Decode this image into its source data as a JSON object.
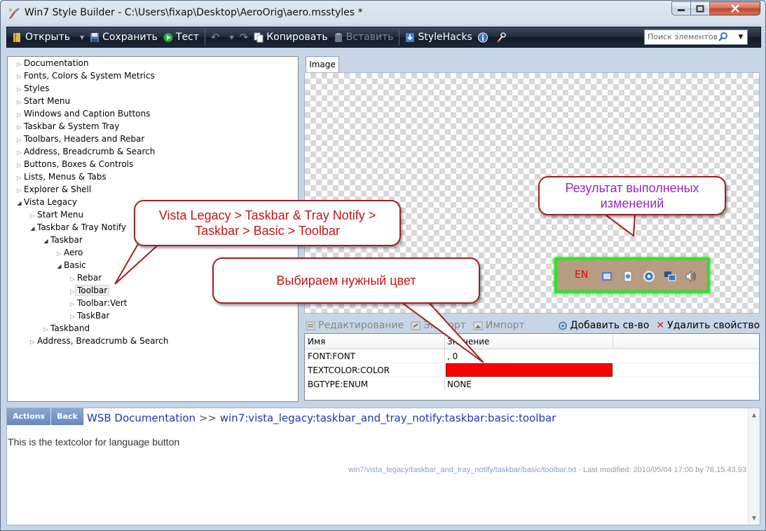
{
  "window": {
    "title": "Win7 Style Builder - C:\\Users\\fixap\\Desktop\\AeroOrig\\aero.msstyles *"
  },
  "toolbar": {
    "open": "Открыть",
    "save": "Сохранить",
    "test": "Тест",
    "copy": "Копировать",
    "paste": "Вставить",
    "stylehacks": "StyleHacks",
    "search_placeholder": "Поиск элементов"
  },
  "tree": {
    "items": [
      {
        "label": "Documentation"
      },
      {
        "label": "Fonts, Colors & System Metrics"
      },
      {
        "label": "Styles"
      },
      {
        "label": "Start Menu"
      },
      {
        "label": "Windows and Caption Buttons"
      },
      {
        "label": "Taskbar & System Tray"
      },
      {
        "label": "Toolbars, Headers and Rebar"
      },
      {
        "label": "Address, Breadcrumb & Search"
      },
      {
        "label": "Buttons, Boxes & Controls"
      },
      {
        "label": "Lists, Menus & Tabs"
      },
      {
        "label": "Explorer & Shell"
      },
      {
        "label": "Vista Legacy"
      },
      {
        "label": "Start Menu"
      },
      {
        "label": "Taskbar & Tray Notify"
      },
      {
        "label": "Taskbar"
      },
      {
        "label": "Aero"
      },
      {
        "label": "Basic"
      },
      {
        "label": "Rebar"
      },
      {
        "label": "Toolbar"
      },
      {
        "label": "Toolbar:Vert"
      },
      {
        "label": "TaskBar"
      },
      {
        "label": "Taskband"
      },
      {
        "label": "Address, Breadcrumb & Search"
      }
    ]
  },
  "preview": {
    "tab": "Image",
    "tray_lang": "EN"
  },
  "prop_toolbar": {
    "edit": "Редактирование",
    "export": "Экспорт",
    "import": "Импорт",
    "add": "Добавить св-во",
    "delete": "Удалить свойство"
  },
  "grid": {
    "headers": {
      "name": "Имя",
      "value": "Значение"
    },
    "rows": [
      {
        "name": "FONT:FONT",
        "value": ", 0"
      },
      {
        "name": "TEXTCOLOR:COLOR",
        "value": "",
        "color": "#ff0000"
      },
      {
        "name": "BGTYPE:ENUM",
        "value": "NONE"
      }
    ]
  },
  "docs": {
    "actions": "Actions",
    "back": "Back",
    "crumb_root": "WSB Documentation",
    "crumb_sep": ">>",
    "crumb_path": "win7:vista_legacy:taskbar_and_tray_notify:taskbar:basic:toolbar",
    "text": "This is the textcolor for language button",
    "meta_file": "win7/vista_legacy/taskbar_and_tray_notify/taskbar/basic/toolbar.txt",
    "meta_modified": "· Last modified: 2010/05/04 17:00 by 76.15.43.93"
  },
  "callouts": {
    "path_line1": "Vista Legacy > Taskbar & Tray Notify >",
    "path_line2": "Taskbar > Basic > Toolbar",
    "pick_color": "Выбираем нужный цвет",
    "result_line1": "Результат выполненых",
    "result_line2": "изменений"
  },
  "colors": {
    "accent_green": "#27e627",
    "callout_red": "#c0161a",
    "callout_purple": "#9b27b8",
    "link_blue": "#1d3aa8"
  }
}
